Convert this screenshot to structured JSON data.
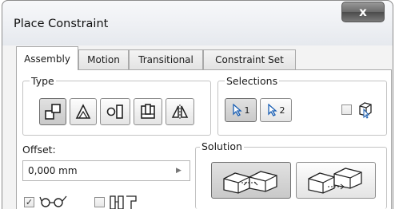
{
  "window": {
    "title": "Place Constraint",
    "close_label": "x"
  },
  "tabs": [
    {
      "label": "Assembly",
      "active": true
    },
    {
      "label": "Motion",
      "active": false
    },
    {
      "label": "Transitional",
      "active": false
    },
    {
      "label": "Constraint Set",
      "active": false
    }
  ],
  "type_group": {
    "label": "Type",
    "buttons": [
      {
        "name": "mate",
        "icon": "mate-constraint-icon",
        "pressed": true
      },
      {
        "name": "angle",
        "icon": "angle-constraint-icon",
        "pressed": false
      },
      {
        "name": "tangent",
        "icon": "tangent-constraint-icon",
        "pressed": false
      },
      {
        "name": "insert",
        "icon": "insert-constraint-icon",
        "pressed": false
      },
      {
        "name": "symmetry",
        "icon": "symmetry-constraint-icon",
        "pressed": false
      }
    ]
  },
  "selections_group": {
    "label": "Selections",
    "buttons": [
      {
        "number": "1",
        "icon": "cursor-select-icon",
        "pressed": true
      },
      {
        "number": "2",
        "icon": "cursor-select-icon",
        "pressed": false
      }
    ],
    "pick_part_first": {
      "checked": false,
      "icon": "pick-part-first-icon"
    }
  },
  "offset": {
    "label": "Offset:",
    "value": "0,000 mm"
  },
  "solution_group": {
    "label": "Solution",
    "buttons": [
      {
        "name": "mate-solution",
        "icon": "mate-solution-icon",
        "pressed": true
      },
      {
        "name": "flush-solution",
        "icon": "flush-solution-icon",
        "pressed": false
      }
    ]
  },
  "options": {
    "show_preview": {
      "checked": true,
      "icon": "show-preview-icon"
    },
    "predict_offset": {
      "checked": false,
      "icon": "predict-offset-icon"
    }
  },
  "colors": {
    "accent": "#1a5fb4",
    "panel": "#ffffff",
    "chrome": "#f3f3f3"
  }
}
